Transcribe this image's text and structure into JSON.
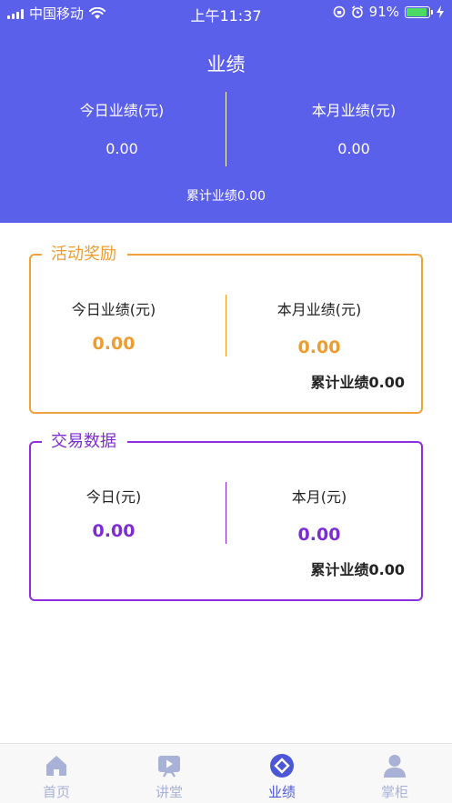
{
  "status_bar": {
    "carrier": "中国移动",
    "time": "上午11:37",
    "battery_percent": "91%",
    "battery_level": 0.91,
    "colors": {
      "battery_fill": "#4cd964"
    }
  },
  "header": {
    "title": "业绩",
    "today_label": "今日业绩(元)",
    "today_value": "0.00",
    "month_label": "本月业绩(元)",
    "month_value": "0.00",
    "total_text": "累计业绩0.00",
    "background_color": "#5b60ea"
  },
  "activity_card": {
    "title": "活动奖励",
    "today_label": "今日业绩(元)",
    "today_value": "0.00",
    "month_label": "本月业绩(元)",
    "month_value": "0.00",
    "total_text": "累计业绩0.00",
    "accent_color": "#ef9c2f"
  },
  "trade_card": {
    "title": "交易数据",
    "today_label": "今日(元)",
    "today_value": "0.00",
    "month_label": "本月(元)",
    "month_value": "0.00",
    "total_text": "累计业绩0.00",
    "accent_color": "#7d2cd4"
  },
  "tabbar": {
    "items": [
      {
        "label": "首页",
        "icon": "home-icon",
        "active": false
      },
      {
        "label": "讲堂",
        "icon": "video-icon",
        "active": false
      },
      {
        "label": "业绩",
        "icon": "performance-icon",
        "active": true
      },
      {
        "label": "掌柜",
        "icon": "person-icon",
        "active": false
      }
    ],
    "colors": {
      "active": "#4c57d8",
      "inactive": "#a8b1d6"
    }
  }
}
